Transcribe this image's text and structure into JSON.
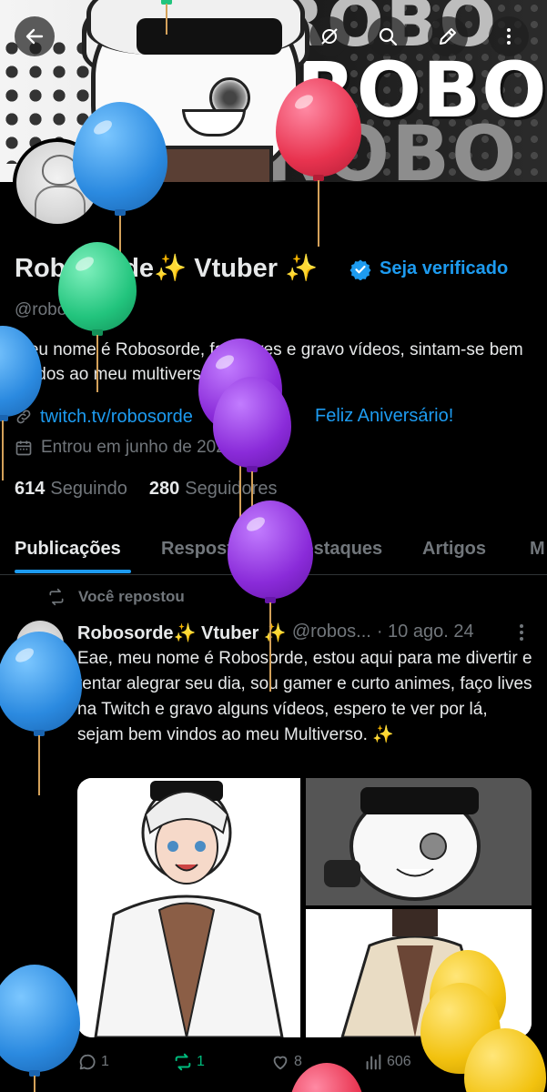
{
  "header": {
    "back_icon": "arrow-left-icon",
    "actions": [
      "notifications-off-icon",
      "search-icon",
      "edit-icon",
      "more-vertical-icon"
    ],
    "banner_word": "ROBO"
  },
  "profile": {
    "display_name": "Robosorde✨ Vtuber ✨",
    "verify_label": "Seja verificado",
    "handle": "@robosorde",
    "bio": "Meu nome é Robosorde, faço lives e gravo vídeos, sintam-se bem vindos ao meu multiverso",
    "link": "twitch.tv/robosorde",
    "birthday": "Feliz Aniversário!",
    "joined": "Entrou em junho de 2020",
    "following_count": "614",
    "following_label": "Seguindo",
    "followers_count": "280",
    "followers_label": "Seguidores"
  },
  "tabs": [
    {
      "label": "Publicações",
      "active": true
    },
    {
      "label": "Respostas"
    },
    {
      "label": "Destaques"
    },
    {
      "label": "Artigos"
    },
    {
      "label": "M"
    }
  ],
  "post": {
    "repost_label": "Você repostou",
    "author": "Robosorde✨ Vtuber ✨",
    "handle": "@robos...",
    "date": "· 10 ago. 24",
    "text": "Eae, meu nome é Robosorde, estou aqui para me divertir e tentar alegrar seu dia, sou gamer e curto animes, faço lives na Twitch e gravo alguns vídeos, espero te ver por lá, sejam bem vindos ao meu Multiverso. ✨",
    "replies": "1",
    "reposts": "1",
    "likes": "8",
    "views": "606"
  },
  "colors": {
    "accent": "#1d9bf0",
    "background": "#000000",
    "text": "#e7e9ea",
    "muted": "#71767b",
    "repost_green": "#00ba7c"
  }
}
